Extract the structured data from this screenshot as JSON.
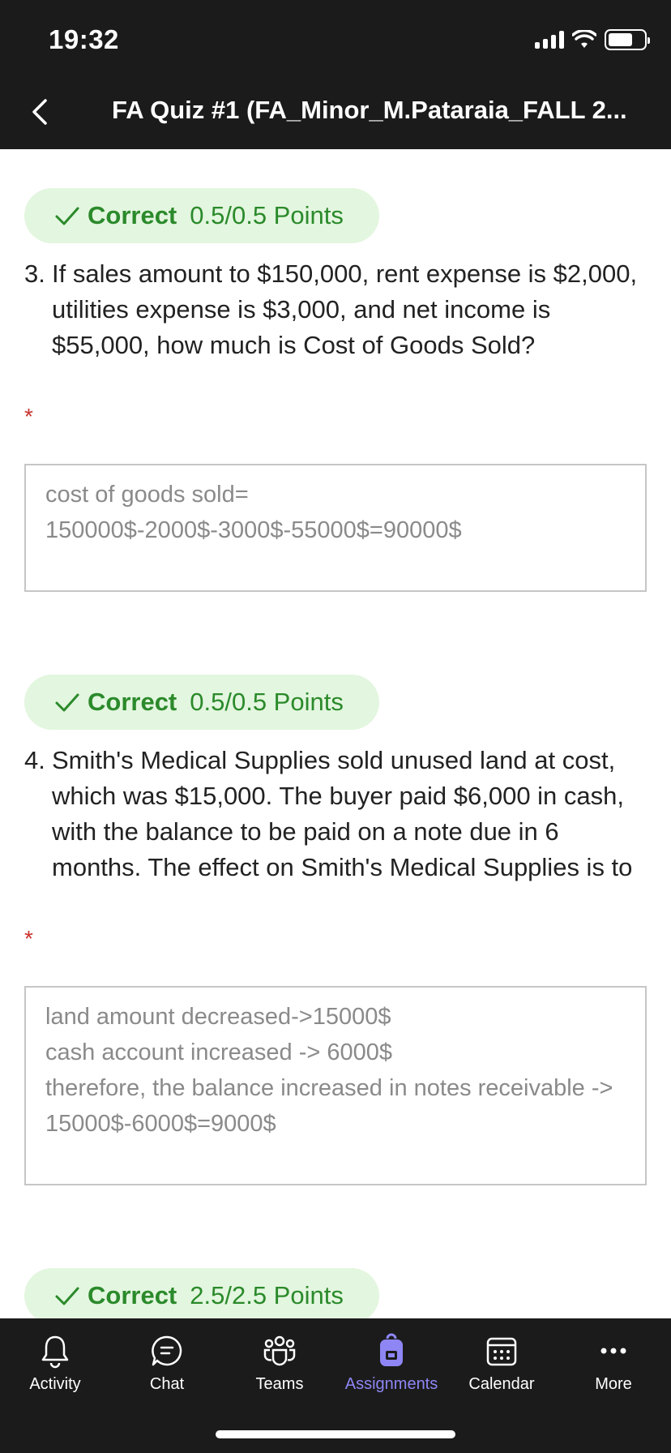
{
  "status_bar": {
    "time": "19:32"
  },
  "header": {
    "title": "FA Quiz #1  (FA_Minor_M.Pataraia_FALL 2..."
  },
  "questions": [
    {
      "badge": {
        "label": "Correct",
        "points": "0.5/0.5 Points"
      },
      "number": "3.",
      "text": "If sales amount to $150,000, rent expense is $2,000, utilities expense is $3,000, and net income is $55,000, how much is Cost of Goods Sold?",
      "required_mark": "*",
      "answer": "cost of goods sold=\n150000$-2000$-3000$-55000$=90000$"
    },
    {
      "badge": {
        "label": "Correct",
        "points": "0.5/0.5 Points"
      },
      "number": "4.",
      "text": "Smith's Medical Supplies sold unused land at cost, which was $15,000. The buyer paid $6,000 in cash, with the balance to be paid on a note due in 6 months. The effect on Smith's Medical Supplies is to",
      "required_mark": "*",
      "answer": "land amount decreased->15000$\ncash account increased -> 6000$\ntherefore, the balance increased in notes receivable -> 15000$-6000$=9000$"
    },
    {
      "badge": {
        "label": "Correct",
        "points": "2.5/2.5 Points"
      }
    }
  ],
  "tabbar": {
    "items": [
      {
        "label": "Activity",
        "icon": "bell-icon",
        "active": false
      },
      {
        "label": "Chat",
        "icon": "chat-icon",
        "active": false
      },
      {
        "label": "Teams",
        "icon": "teams-icon",
        "active": false
      },
      {
        "label": "Assignments",
        "icon": "backpack-icon",
        "active": true
      },
      {
        "label": "Calendar",
        "icon": "calendar-icon",
        "active": false
      },
      {
        "label": "More",
        "icon": "more-icon",
        "active": false
      }
    ]
  },
  "colors": {
    "header_bg": "#1b1b1b",
    "correct_green": "#2b8a2b",
    "badge_bg": "#e3f6df",
    "required_red": "#c8322d",
    "active_tab": "#8e86f5"
  }
}
